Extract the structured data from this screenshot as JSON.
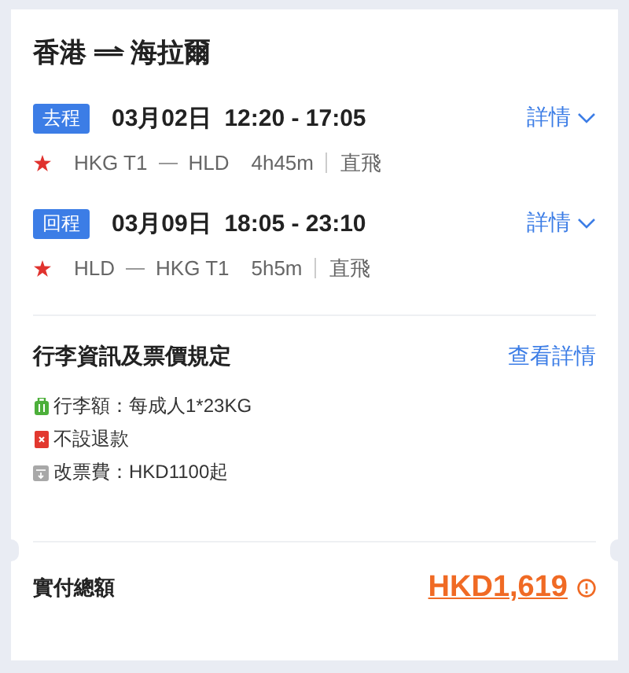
{
  "route": {
    "origin": "香港",
    "destination": "海拉爾"
  },
  "legs": [
    {
      "badge": "去程",
      "datetime": "03月02日  12:20 - 17:05",
      "details": "詳情",
      "from": "HKG T1",
      "to": "HLD",
      "duration": "4h45m",
      "type": "直飛"
    },
    {
      "badge": "回程",
      "datetime": "03月09日  18:05 - 23:10",
      "details": "詳情",
      "from": "HLD",
      "to": "HKG T1",
      "duration": "5h5m",
      "type": "直飛"
    }
  ],
  "rules": {
    "title": "行李資訊及票價規定",
    "link": "查看詳情",
    "items": [
      {
        "kind": "luggage",
        "text": "行李額：每成人1*23KG"
      },
      {
        "kind": "refund",
        "text": "不設退款"
      },
      {
        "kind": "change",
        "text": "改票費：HKD1100起"
      }
    ]
  },
  "total": {
    "label": "實付總額",
    "amount": "HKD1,619"
  }
}
